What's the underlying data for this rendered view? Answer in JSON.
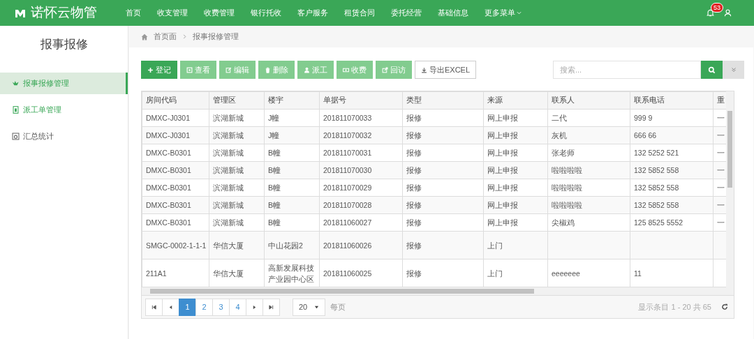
{
  "app": {
    "logo_text": "诺怀云物管"
  },
  "nav": [
    "首页",
    "收支管理",
    "收费管理",
    "银行托收",
    "客户服务",
    "租赁合同",
    "委托经营",
    "基础信息",
    "更多菜单"
  ],
  "notifications": {
    "count": "53"
  },
  "sidebar": {
    "title": "报事报修",
    "items": [
      {
        "label": "报事报修管理",
        "selected": true
      },
      {
        "label": "派工单管理",
        "selected": false
      },
      {
        "label": "汇总统计",
        "selected": false
      }
    ]
  },
  "breadcrumb": [
    "首页面",
    "报事报修管理"
  ],
  "toolbar": [
    {
      "label": "登记",
      "kind": "primary"
    },
    {
      "label": "查看",
      "kind": "light"
    },
    {
      "label": "编辑",
      "kind": "light"
    },
    {
      "label": "删除",
      "kind": "light"
    },
    {
      "label": "派工",
      "kind": "light"
    },
    {
      "label": "收费",
      "kind": "light"
    },
    {
      "label": "回访",
      "kind": "light"
    },
    {
      "label": "导出EXCEL",
      "kind": "outline"
    }
  ],
  "search": {
    "placeholder": "搜索..."
  },
  "table": {
    "columns": [
      "房间代码",
      "管理区",
      "楼宇",
      "单据号",
      "类型",
      "来源",
      "联系人",
      "联系电话",
      "重"
    ],
    "rows": [
      [
        "DMXC-J0301",
        "滨湖新城",
        "J幢",
        "201811070033",
        "报修",
        "网上申报",
        "二代",
        "999 9",
        "一"
      ],
      [
        "DMXC-J0301",
        "滨湖新城",
        "J幢",
        "201811070032",
        "报修",
        "网上申报",
        "灰机",
        "666 66",
        "一"
      ],
      [
        "DMXC-B0301",
        "滨湖新城",
        "B幢",
        "201811070031",
        "报修",
        "网上申报",
        "张老师",
        "132 5252 521",
        "一"
      ],
      [
        "DMXC-B0301",
        "滨湖新城",
        "B幢",
        "201811070030",
        "报修",
        "网上申报",
        "啦啦啦啦",
        "132 5852 558",
        "一"
      ],
      [
        "DMXC-B0301",
        "滨湖新城",
        "B幢",
        "201811070029",
        "报修",
        "网上申报",
        "啦啦啦啦",
        "132 5852 558",
        "一"
      ],
      [
        "DMXC-B0301",
        "滨湖新城",
        "B幢",
        "201811070028",
        "报修",
        "网上申报",
        "啦啦啦啦",
        "132 5852 558",
        "一"
      ],
      [
        "DMXC-B0301",
        "滨湖新城",
        "B幢",
        "201811060027",
        "报修",
        "网上申报",
        "尖椒鸡",
        "125 8525 5552",
        "一"
      ],
      [
        "SMGC-0002-1-1-1",
        "华信大厦",
        "中山花园2",
        "201811060026",
        "报修",
        "上门",
        "",
        "",
        ""
      ],
      [
        "211A1",
        "华信大厦",
        "高新发展科技产业园中心区",
        "201811060025",
        "报修",
        "上门",
        "eeeeeee",
        "11",
        ""
      ]
    ]
  },
  "pagination": {
    "pages": [
      {
        "label": "1",
        "selected": true
      },
      {
        "label": "2",
        "selected": false
      },
      {
        "label": "3",
        "selected": false
      },
      {
        "label": "4",
        "selected": false
      }
    ],
    "page_size": "20",
    "page_size_label": "每页",
    "summary": "显示条目 1 - 20 共 65"
  }
}
